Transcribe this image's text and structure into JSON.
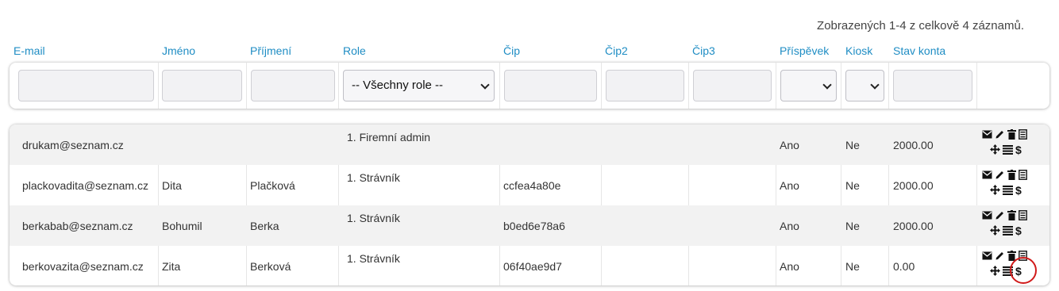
{
  "summary": "Zobrazených 1-4 z celkově 4 záznamů.",
  "columns": {
    "email": "E-mail",
    "jmeno": "Jméno",
    "prijmeni": "Příjmení",
    "role": "Role",
    "cip": "Čip",
    "cip2": "Čip2",
    "cip3": "Čip3",
    "prispevek": "Příspěvek",
    "kiosk": "Kiosk",
    "stav_konta": "Stav konta"
  },
  "filters": {
    "role_selected": "-- Všechny role --",
    "prispevek_selected": "",
    "kiosk_selected": ""
  },
  "rows": [
    {
      "email": "drukam@seznam.cz",
      "jmeno": "",
      "prijmeni": "",
      "role": "1. Firemní admin",
      "cip": "",
      "cip2": "",
      "cip3": "",
      "prispevek": "Ano",
      "kiosk": "Ne",
      "stav": "2000.00"
    },
    {
      "email": "plackovadita@seznam.cz",
      "jmeno": "Dita",
      "prijmeni": "Plačková",
      "role": "1. Strávník",
      "cip": "ccfea4a80e",
      "cip2": "",
      "cip3": "",
      "prispevek": "Ano",
      "kiosk": "Ne",
      "stav": "2000.00"
    },
    {
      "email": "berkabab@seznam.cz",
      "jmeno": "Bohumil",
      "prijmeni": "Berka",
      "role": "1. Strávník",
      "cip": "b0ed6e78a6",
      "cip2": "",
      "cip3": "",
      "prispevek": "Ano",
      "kiosk": "Ne",
      "stav": "2000.00"
    },
    {
      "email": "berkovazita@seznam.cz",
      "jmeno": "Zita",
      "prijmeni": "Berková",
      "role": "1. Strávník",
      "cip": "06f40ae9d7",
      "cip2": "",
      "cip3": "",
      "prispevek": "Ano",
      "kiosk": "Ne",
      "stav": "0.00"
    }
  ],
  "actions": {
    "icons": [
      "envelope-icon",
      "pencil-icon",
      "trash-icon",
      "document-icon",
      "move-icon",
      "list-icon",
      "dollar-icon"
    ],
    "dollar_label": "$"
  },
  "colors": {
    "header_link": "#1f8dc4",
    "highlight_circle": "#d11a1a",
    "row_shade": "#f2f2f2"
  }
}
